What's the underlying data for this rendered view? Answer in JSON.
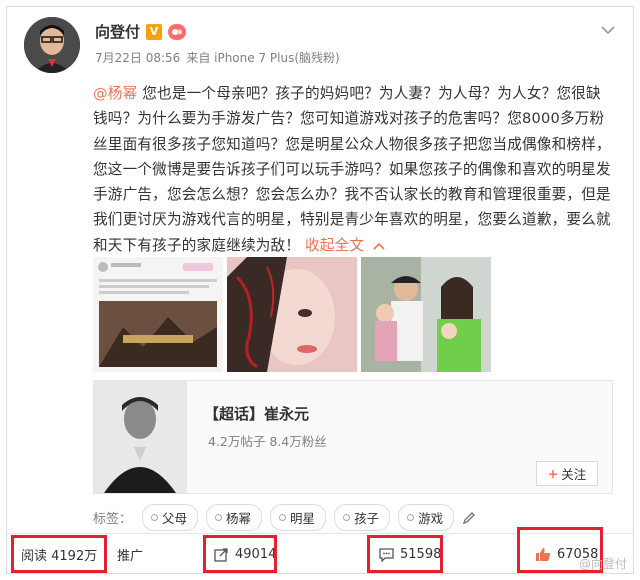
{
  "author": {
    "name": "向登付",
    "vip_badge": "V",
    "level_badge": "lv"
  },
  "meta": {
    "date": "7月22日 08:56",
    "source": "来自 iPhone 7 Plus(脑残粉)"
  },
  "post": {
    "mention": "@杨幂",
    "body": " 您也是一个母亲吧？孩子的妈妈吧？为人妻？为人母？为人女？您很缺钱吗？为什么要为手游发广告？您可知道游戏对孩子的危害吗？您8000多万粉丝里面有很多孩子您知道吗？您是明星公众人物很多孩子把您当成偶像和榜样，您这一个微博是要告诉孩子们可以玩手游吗？如果您孩子的偶像和喜欢的明星发手游广告，您会怎么想？您会怎么办？我不否认家长的教育和管理很重要，但是我们更讨厌为游戏代言的明星，特别是青少年喜欢的明星，您要么道歉，要么就和天下有孩子的家庭继续为敌！",
    "collapse_label": "收起全文",
    "collapse_icon": "chevron-up-icon"
  },
  "supertopic": {
    "title": "【超话】崔永元",
    "stats": "4.2万帖子 8.4万粉丝",
    "follow_label": "关注"
  },
  "tags": {
    "label": "标签：",
    "items": [
      "父母",
      "杨幂",
      "明星",
      "孩子",
      "游戏"
    ]
  },
  "actions": {
    "read": "阅读 4192万",
    "promote": "推广",
    "reposts": "49014",
    "comments": "51598",
    "likes": "67058"
  },
  "watermark": "@向登付",
  "colors": {
    "accent": "#eb7350",
    "highlight": "#e6212f",
    "vip": "#f7a10b"
  }
}
